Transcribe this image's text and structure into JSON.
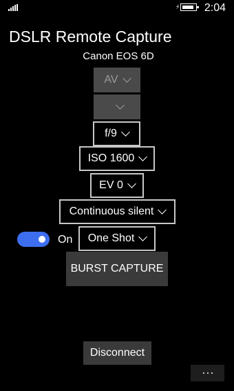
{
  "status": {
    "time": "2:04"
  },
  "header": {
    "title": "DSLR Remote Capture",
    "camera_model": "Canon EOS 6D"
  },
  "controls": {
    "mode": {
      "value": "AV",
      "enabled": false
    },
    "blank": {
      "value": "",
      "enabled": false
    },
    "aperture": {
      "value": "f/9"
    },
    "iso": {
      "value": "ISO 1600"
    },
    "ev": {
      "value": "EV 0"
    },
    "drive_mode": {
      "value": "Continuous silent"
    },
    "toggle": {
      "state_label": "On",
      "on": true
    },
    "shot_mode": {
      "value": "One Shot"
    }
  },
  "buttons": {
    "burst_capture": "BURST CAPTURE",
    "disconnect": "Disconnect"
  },
  "colors": {
    "accent": "#3e6ef0",
    "background": "#000000",
    "button": "#3a3a3a"
  }
}
